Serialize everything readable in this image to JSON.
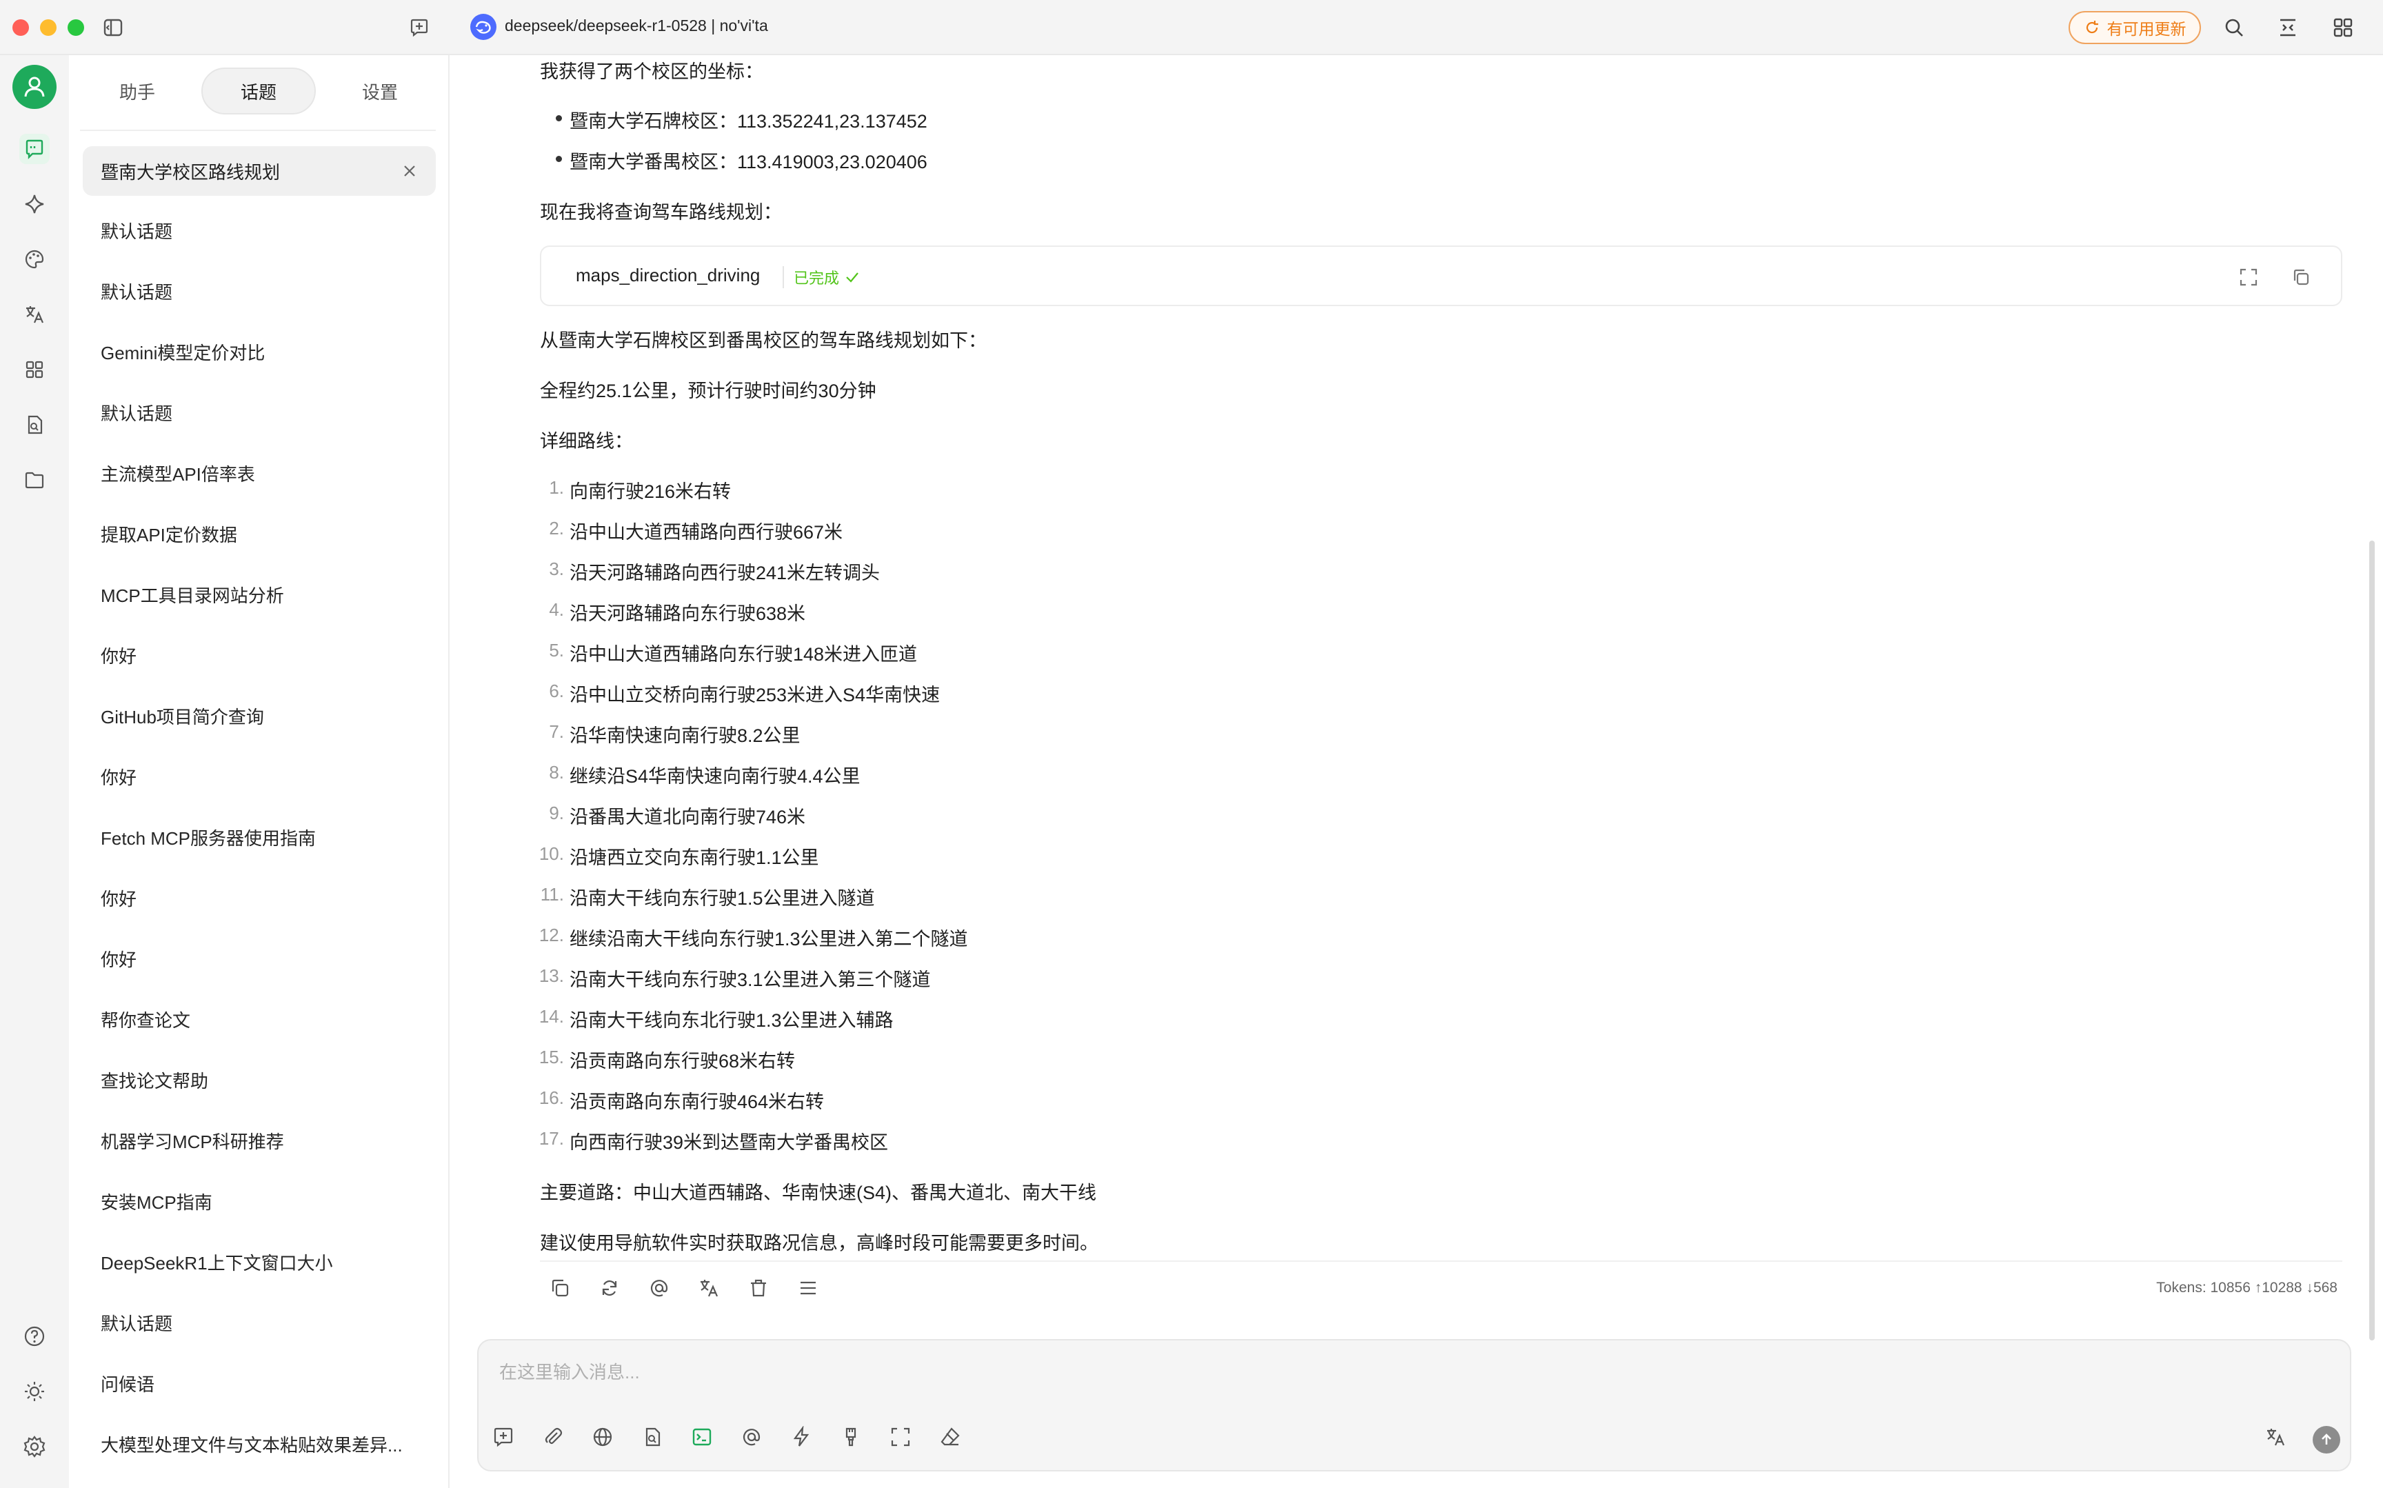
{
  "titlebar": {
    "model_title": "deepseek/deepseek-r1-0528 | no'vi'ta",
    "update_label": "有可用更新"
  },
  "sidebar": {
    "tabs": [
      {
        "label": "助手"
      },
      {
        "label": "话题"
      },
      {
        "label": "设置"
      }
    ],
    "active_topic": "暨南大学校区路线规划",
    "topics": [
      "默认话题",
      "默认话题",
      "Gemini模型定价对比",
      "默认话题",
      "主流模型API倍率表",
      "提取API定价数据",
      "MCP工具目录网站分析",
      "你好",
      "GitHub项目简介查询",
      "你好",
      "Fetch MCP服务器使用指南",
      "你好",
      "你好",
      "帮你查论文",
      "查找论文帮助",
      "机器学习MCP科研推荐",
      "安装MCP指南",
      "DeepSeekR1上下文窗口大小",
      "默认话题",
      "问候语",
      "大模型处理文件与文本粘贴效果差异..."
    ]
  },
  "message": {
    "intro": "我获得了两个校区的坐标：",
    "campuses": [
      "暨南大学石牌校区：113.352241,23.137452",
      "暨南大学番禺校区：113.419003,23.020406"
    ],
    "query_text": "现在我将查询驾车路线规划：",
    "tool": {
      "name": "maps_direction_driving",
      "status": "已完成"
    },
    "summary_title": "从暨南大学石牌校区到番禺校区的驾车路线规划如下：",
    "summary_distance": "全程约25.1公里，预计行驶时间约30分钟",
    "detail_title": "详细路线：",
    "steps": [
      "向南行驶216米右转",
      "沿中山大道西辅路向西行驶667米",
      "沿天河路辅路向西行驶241米左转调头",
      "沿天河路辅路向东行驶638米",
      "沿中山大道西辅路向东行驶148米进入匝道",
      "沿中山立交桥向南行驶253米进入S4华南快速",
      "沿华南快速向南行驶8.2公里",
      "继续沿S4华南快速向南行驶4.4公里",
      "沿番禺大道北向南行驶746米",
      "沿塘西立交向东南行驶1.1公里",
      "沿南大干线向东行驶1.5公里进入隧道",
      "继续沿南大干线向东行驶1.3公里进入第二个隧道",
      "沿南大干线向东行驶3.1公里进入第三个隧道",
      "沿南大干线向东北行驶1.3公里进入辅路",
      "沿贡南路向东行驶68米右转",
      "沿贡南路向东南行驶464米右转",
      "向西南行驶39米到达暨南大学番禺校区"
    ],
    "step_numbers": [
      "1.",
      "2.",
      "3.",
      "4.",
      "5.",
      "6.",
      "7.",
      "8.",
      "9.",
      "10.",
      "11.",
      "12.",
      "13.",
      "14.",
      "15.",
      "16.",
      "17."
    ],
    "main_roads": "主要道路：中山大道西辅路、华南快速(S4)、番禺大道北、南大干线",
    "advice": "建议使用导航软件实时获取路况信息，高峰时段可能需要更多时间。",
    "tokens": "Tokens: 10856 ↑10288 ↓568"
  },
  "input": {
    "placeholder": "在这里输入消息..."
  },
  "colors": {
    "accent_green": "#1eaa5b",
    "update_orange": "#ee7d16",
    "status_green": "#52c41a",
    "deepseek_blue": "#4d6bfe"
  }
}
